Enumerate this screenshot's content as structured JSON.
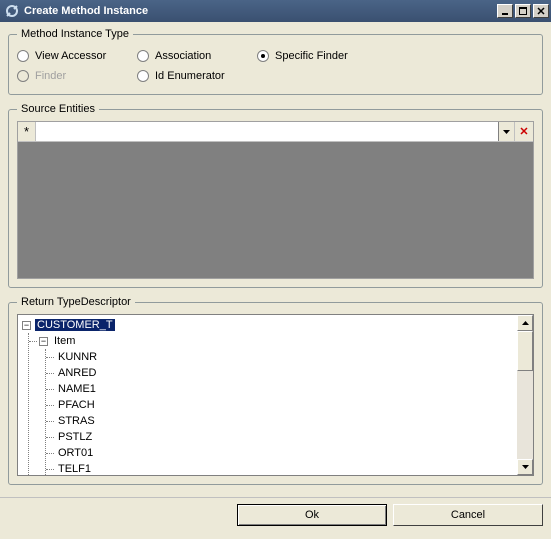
{
  "window": {
    "title": "Create Method Instance"
  },
  "groups": {
    "method_type": {
      "legend": "Method Instance Type",
      "options": {
        "view_accessor": "View Accessor",
        "association": "Association",
        "specific_finder": "Specific Finder",
        "finder": "Finder",
        "id_enumerator": "Id Enumerator"
      },
      "selected": "specific_finder",
      "disabled": [
        "finder"
      ]
    },
    "source_entities": {
      "legend": "Source Entities",
      "new_row_marker": "*",
      "delete_glyph": "✕"
    },
    "return_type": {
      "legend": "Return TypeDescriptor",
      "root": "CUSTOMER_T",
      "item_label": "Item",
      "leaves": [
        "KUNNR",
        "ANRED",
        "NAME1",
        "PFACH",
        "STRAS",
        "PSTLZ",
        "ORT01",
        "TELF1"
      ]
    }
  },
  "buttons": {
    "ok": "Ok",
    "cancel": "Cancel"
  }
}
